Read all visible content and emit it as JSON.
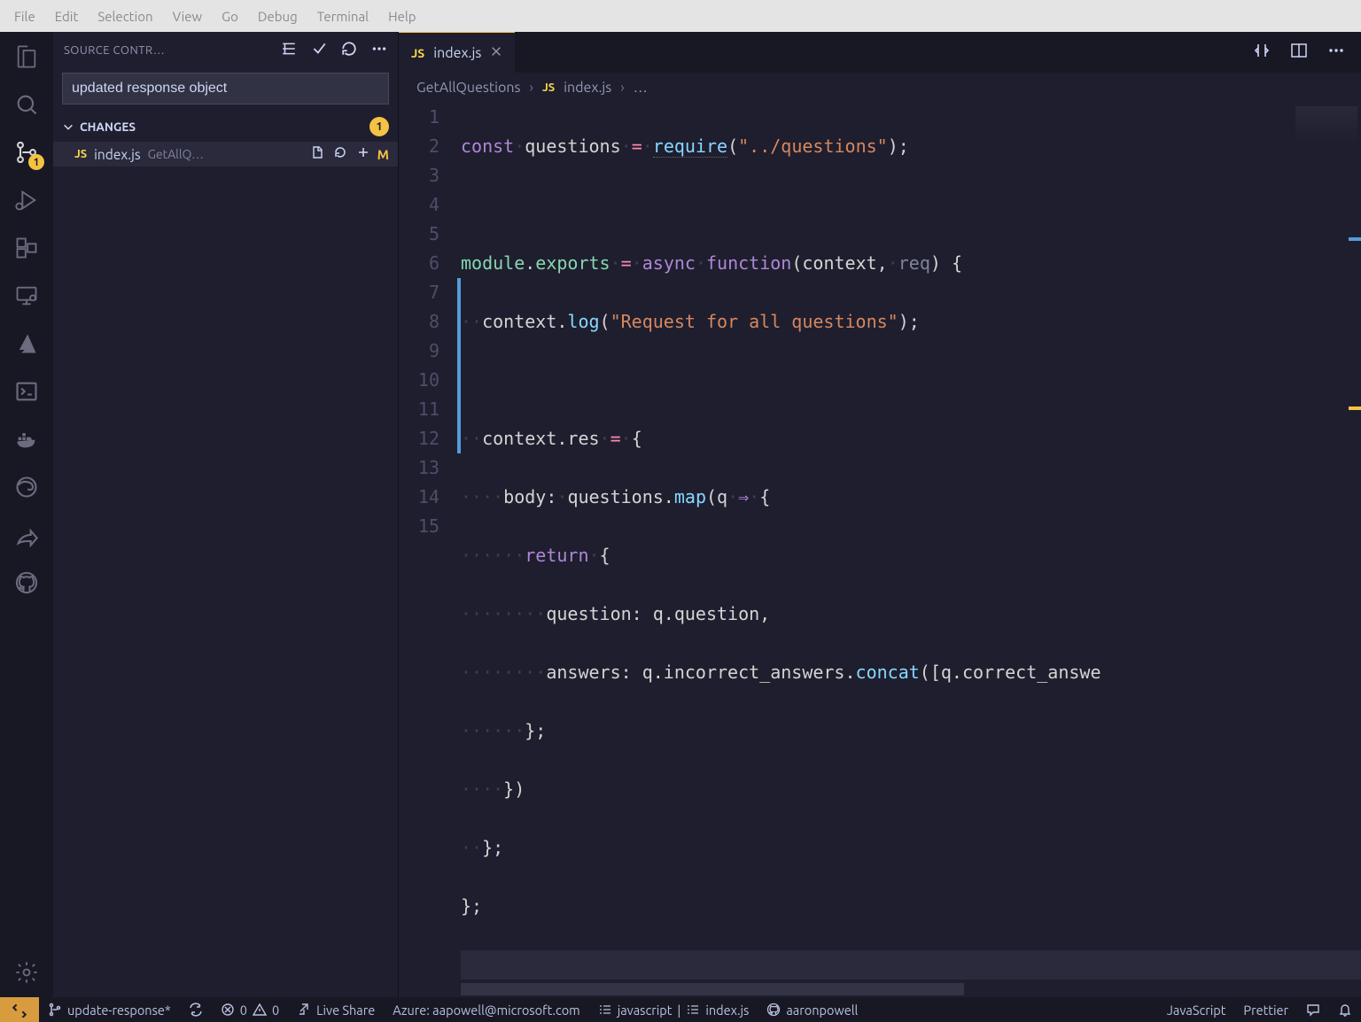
{
  "menubar": [
    "File",
    "Edit",
    "Selection",
    "View",
    "Go",
    "Debug",
    "Terminal",
    "Help"
  ],
  "sidebar": {
    "title": "SOURCE CONTR…",
    "commit_message": "updated response object",
    "changes_label": "CHANGES",
    "changes_count": "1",
    "file": {
      "badge": "JS",
      "name": "index.js",
      "path": "GetAllQ…",
      "status": "M"
    }
  },
  "activity_badge": "1",
  "tab": {
    "badge": "JS",
    "name": "index.js"
  },
  "breadcrumb": {
    "folder": "GetAllQuestions",
    "file_badge": "JS",
    "file": "index.js",
    "tail": "…"
  },
  "line_numbers": [
    "1",
    "2",
    "3",
    "4",
    "5",
    "6",
    "7",
    "8",
    "9",
    "10",
    "11",
    "12",
    "13",
    "14",
    "15"
  ],
  "modified_lines": [
    7,
    8,
    9,
    10,
    11,
    12
  ],
  "code": {
    "l1": {
      "a": "const",
      "b": "questions",
      "c": "=",
      "d": "require",
      "e": "(",
      "f": "\"../questions\"",
      "g": ");"
    },
    "l3": {
      "a": "module",
      "b": ".",
      "c": "exports",
      "d": "=",
      "e": "async",
      "f": "function",
      "g": "(context,",
      "h": "req",
      "i": ") {"
    },
    "l4": {
      "a": "context.",
      "b": "log",
      "c": "(",
      "d": "\"Request for all questions\"",
      "e": ");"
    },
    "l6": {
      "a": "context.res",
      "b": "=",
      "c": "{"
    },
    "l7": {
      "a": "body:",
      "b": "questions.",
      "c": "map",
      "d": "(q",
      "e": "⇒",
      "f": "{"
    },
    "l8": {
      "a": "return",
      "b": "{"
    },
    "l9": {
      "a": "question: q.question,"
    },
    "l10": {
      "a": "answers: q.incorrect_answers.",
      "b": "concat",
      "c": "([q.correct_answe"
    },
    "l11": {
      "a": "};"
    },
    "l12": {
      "a": "})"
    },
    "l13": {
      "a": "};"
    },
    "l14": {
      "a": "};"
    }
  },
  "status": {
    "branch": "update-response*",
    "errors": "0",
    "warnings": "0",
    "liveshare": "Live Share",
    "azure": "Azure: aapowell@microsoft.com",
    "js_label": "javascript",
    "file_label": "index.js",
    "user": "aaronpowell",
    "language": "JavaScript",
    "formatter": "Prettier"
  }
}
